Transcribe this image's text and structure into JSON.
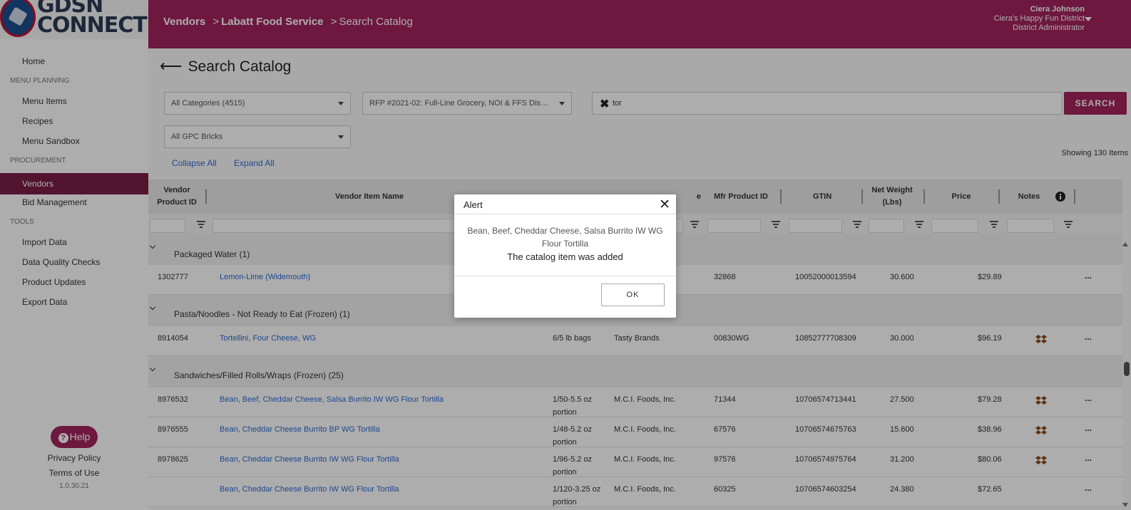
{
  "logo": {
    "text1": "GDSN",
    "text2": "CONNECT"
  },
  "sidebar": {
    "home": "Home",
    "section_menu": "MENU PLANNING",
    "menu_items": "Menu Items",
    "recipes": "Recipes",
    "menu_sandbox": "Menu Sandbox",
    "section_procurement": "PROCUREMENT",
    "vendors": "Vendors",
    "bid_management": "Bid Management",
    "section_tools": "TOOLS",
    "import_data": "Import Data",
    "data_quality": "Data Quality Checks",
    "product_updates": "Product Updates",
    "export_data": "Export Data",
    "help": "Help",
    "privacy": "Privacy Policy",
    "terms": "Terms of Use",
    "version": "1.0.30.21"
  },
  "header": {
    "crumb1": "Vendors",
    "crumb2": "Labatt Food Service",
    "crumb3": "Search Catalog",
    "sep": ">",
    "user_name": "Ciera Johnson",
    "user_district": "Ciera's Happy Fun District",
    "user_role": "District Administrator"
  },
  "main": {
    "title": "Search Catalog",
    "back_arrow": "⟵",
    "category_select": "All Categories (4515)",
    "rfp_select": "RFP #2021-02: Full-Line Grocery, NOI & FFS Distrib...",
    "gpc_select": "All GPC Bricks",
    "search_value": "tor",
    "search_button": "SEARCH",
    "collapse_all": "Collapse All",
    "expand_all": "Expand All",
    "showing": "Showing 130 Items"
  },
  "table": {
    "headers": {
      "vendor_id": "Vendor Product ID",
      "item_name": "Vendor Item Name",
      "brand_partial": "e",
      "mfr_id": "Mfr Product ID",
      "gtin": "GTIN",
      "net_weight": "Net Weight (Lbs)",
      "price": "Price",
      "notes": "Notes"
    },
    "groups": [
      {
        "label": "Packaged Water (1)"
      },
      {
        "label": "Pasta/Noodles - Not Ready to Eat (Frozen) (1)"
      },
      {
        "label": "Sandwiches/Filled Rolls/Wraps (Frozen) (25)"
      }
    ],
    "rows": [
      {
        "id": "1302777",
        "name": "Lemon-Lime (Widemouth)",
        "pack": "",
        "mfr": "",
        "mfr_id": "32868",
        "gtin": "10052000013594",
        "weight": "30.600",
        "price": "$29.89"
      },
      {
        "id": "8914054",
        "name": "Tortellini, Four Cheese, WG",
        "pack": "6/5 lb bags",
        "mfr": "Tasty Brands",
        "mfr_id": "00830WG",
        "gtin": "10852777708309",
        "weight": "30.000",
        "price": "$96.19"
      },
      {
        "id": "8976532",
        "name": "Bean, Beef, Cheddar Cheese, Salsa Burrito IW WG Flour Tortilla",
        "pack": "1/50-5.5 oz portion",
        "mfr": "M.C.I. Foods, Inc.",
        "mfr_id": "71344",
        "gtin": "10706574713441",
        "weight": "27.500",
        "price": "$79.28"
      },
      {
        "id": "8976555",
        "name": "Bean, Cheddar Cheese Burrito BP WG Tortilla",
        "pack": "1/48-5.2 oz portion",
        "mfr": "M.C.I. Foods, Inc.",
        "mfr_id": "67576",
        "gtin": "10706574675763",
        "weight": "15.600",
        "price": "$38.96"
      },
      {
        "id": "8978625",
        "name": "Bean, Cheddar Cheese Burrito IW WG Flour Tortilla",
        "pack": "1/96-5.2 oz portion",
        "mfr": "M.C.I. Foods, Inc.",
        "mfr_id": "97576",
        "gtin": "10706574975764",
        "weight": "31.200",
        "price": "$80.06"
      },
      {
        "id": "",
        "name": "Bean, Cheddar Cheese Burrito IW WG Flour Tortilla",
        "pack": "1/120-3.25 oz portion",
        "mfr": "M.C.I. Foods, Inc.",
        "mfr_id": "60325",
        "gtin": "10706574603254",
        "weight": "24.380",
        "price": "$72.65"
      }
    ],
    "more": "..."
  },
  "dialog": {
    "title": "Alert",
    "close": "✕",
    "item": "Bean, Beef, Cheddar Cheese, Salsa Burrito IW WG Flour Tortilla",
    "message": "The catalog item was added",
    "ok": "OK"
  },
  "colors": {
    "brand": "#a3245d",
    "sidebar_active": "#7a1e46",
    "link": "#2e6bd0"
  }
}
